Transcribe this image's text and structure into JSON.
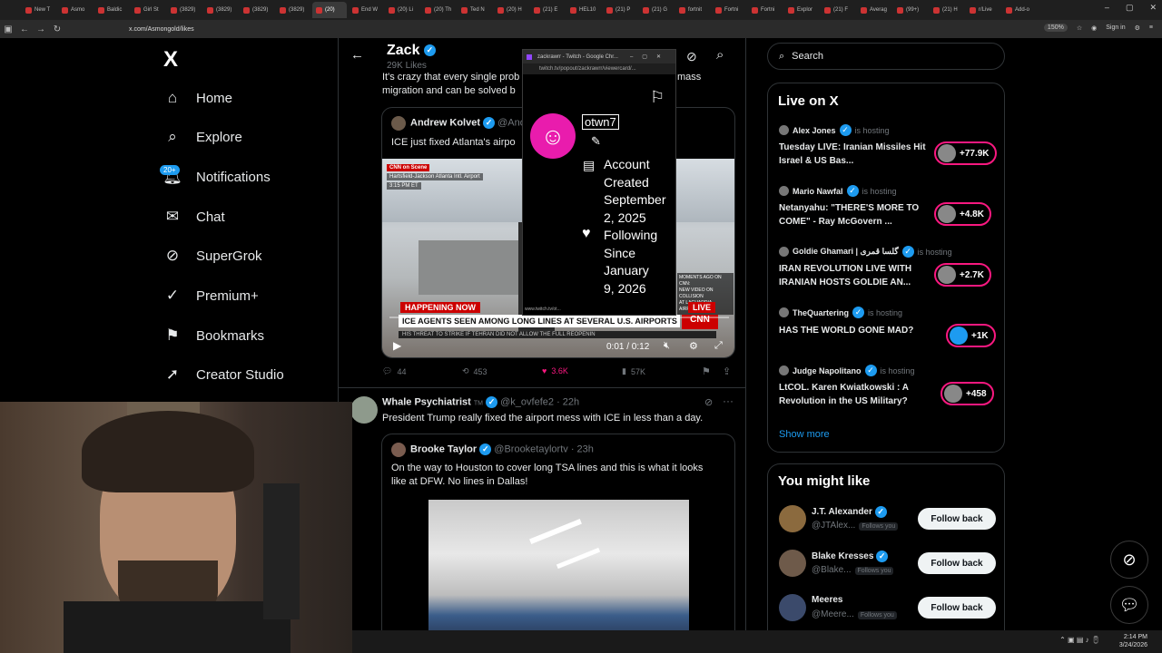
{
  "browser": {
    "tabs": [
      "New T",
      "Asmo",
      "Baldic",
      "Girl St",
      "(3829)",
      "(3829)",
      "(3829)",
      "(3829)",
      "(20)",
      "End W",
      "(20) Li",
      "(20) Th",
      "Ted N",
      "(20) H",
      "(21) E",
      "HEL10",
      "(21) P",
      "(21) G",
      "fortnit",
      "Fortni",
      "Fortni",
      "Explor",
      "(21) F",
      "Averag",
      "(99+)",
      "(21) H",
      "r/Live",
      "Add-o"
    ],
    "url": "x.com/Asmongold/likes",
    "zoom": "150%",
    "sign_in": "Sign in"
  },
  "nav": {
    "logo": "X",
    "items": [
      "Home",
      "Explore",
      "Notifications",
      "Chat",
      "SuperGrok",
      "Premium+",
      "Bookmarks",
      "Creator Studio"
    ],
    "notif_badge": "20+"
  },
  "profile_header": {
    "name": "Zack",
    "likes": "29K Likes"
  },
  "tweet1": {
    "text_line1": "It's crazy that every single prob",
    "text_line1_end": "mass",
    "text_line2": "migration and can be solved b",
    "quote": {
      "author": "Andrew Kolvet",
      "handle": "@And",
      "text": "ICE just fixed Atlanta's airpo",
      "video": {
        "cnn_tag": "on Scene",
        "location": "Hartsfield-Jackson Atlanta Intl. Airport",
        "time": "3:15 PM ET",
        "happening_now": "HAPPENING NOW",
        "headline": "ICE AGENTS SEEN AMONG LONG LINES AT SEVERAL U.S. AIRPORTS",
        "ticker": "HIS THREAT TO STRIKE IF TEHRAN DID NOT ALLOW THE FULL REOPENIN",
        "live": "LIVE",
        "side_text_1": "MOMENTS AGO ON CNN:",
        "side_text_2": "NEW VIDEO ON COLLISION",
        "side_text_3": "AT LAGUARDIA AIRPORT",
        "timecode": "0:01 / 0:12"
      }
    },
    "stats": {
      "replies": "44",
      "reposts": "453",
      "likes": "3.6K",
      "views": "57K"
    }
  },
  "tweet2": {
    "author": "Whale Psychiatrist",
    "tm": "TM",
    "handle": "@k_ovfefe2",
    "time": "· 22h",
    "text": "President Trump really fixed the airport mess with ICE in less than a day.",
    "quote": {
      "author": "Brooke Taylor",
      "handle": "@Brooketaylortv",
      "time": "· 23h",
      "text_line1": "On the way to Houston to cover long TSA lines and this is what it looks",
      "text_line2": "like at DFW. No lines in Dallas!"
    }
  },
  "popup": {
    "title": "zackrawrr - Twitch - Google Chr...",
    "url": "twitch.tv/popout/zackrawrr/viewercard/...",
    "username": "otwn7",
    "created_lines": [
      "Account",
      "Created",
      "September",
      "2, 2025"
    ],
    "following_lines": [
      "Following",
      "Since",
      "January",
      "9, 2026"
    ],
    "status_url": "www.twitch.tv/ot..."
  },
  "right": {
    "search_placeholder": "Search",
    "live_title": "Live on X",
    "live": [
      {
        "host": "Alex Jones",
        "status": "is hosting",
        "title": "Tuesday LIVE: Iranian Missiles Hit Israel & US Bas...",
        "count": "+77.9K"
      },
      {
        "host": "Mario Nawfal",
        "status": "is hosting",
        "title": "Netanyahu: \"THERE'S MORE TO COME\" - Ray McGovern ...",
        "count": "+4.8K"
      },
      {
        "host": "Goldie Ghamari | گلسا قمری",
        "status": "is hosting",
        "title": "IRAN REVOLUTION LIVE WITH IRANIAN HOSTS GOLDIE AN...",
        "count": "+2.7K"
      },
      {
        "host": "TheQuartering",
        "status": "is hosting",
        "title": "HAS THE WORLD GONE MAD?",
        "count": "+1K"
      },
      {
        "host": "Judge Napolitano",
        "status": "is hosting",
        "title": "LtCOL. Karen Kwiatkowski : A Revolution in the US Military?",
        "count": "+458"
      }
    ],
    "show_more": "Show more",
    "might_like_title": "You might like",
    "suggestions": [
      {
        "name": "J.T. Alexander",
        "handle": "@JTAlex...",
        "follows": "Follows you",
        "button": "Follow back"
      },
      {
        "name": "Blake Kresses",
        "handle": "@Blake...",
        "follows": "Follows you",
        "button": "Follow back"
      },
      {
        "name": "Meeres",
        "handle": "@Meere...",
        "follows": "Follows you",
        "button": "Follow back"
      }
    ]
  },
  "taskbar": {
    "time": "2:14 PM",
    "date": "3/24/2026"
  },
  "colors": {
    "accent": "#1d9bf0",
    "like": "#f91880",
    "bg": "#000000",
    "border": "#2f3336"
  }
}
